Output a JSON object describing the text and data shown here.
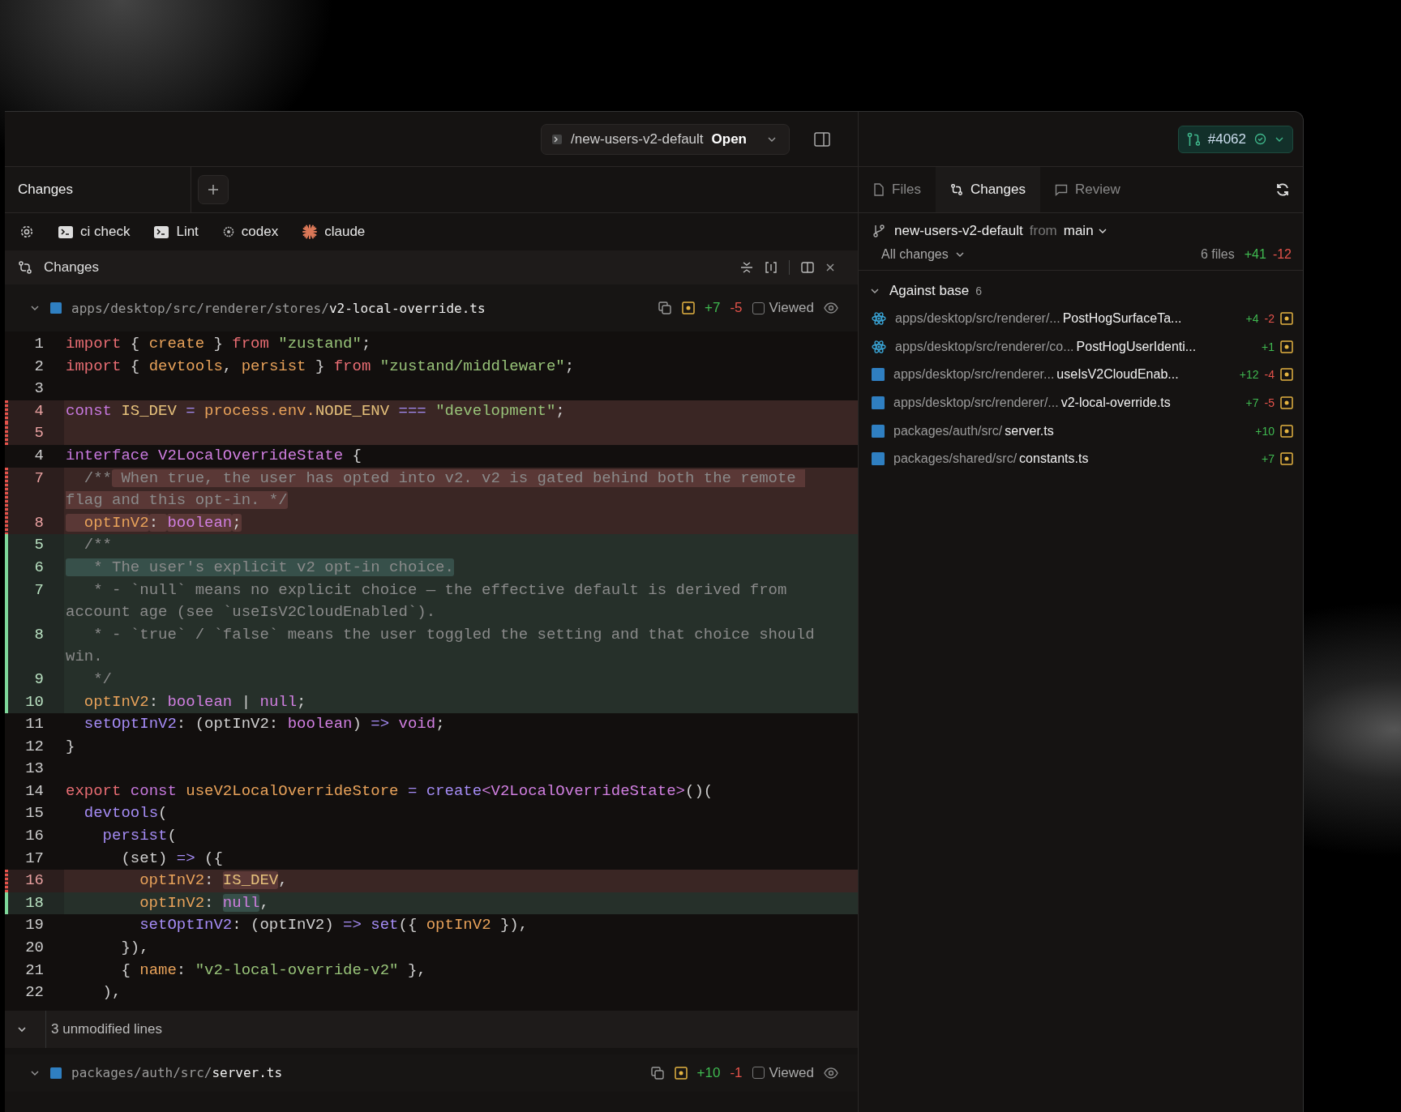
{
  "title_bar": {
    "branch_path": "/new-users-v2-default",
    "status": "Open",
    "pr_number": "#4062"
  },
  "left_tabs": [
    {
      "label": "Changes",
      "selected": true
    }
  ],
  "toolbar": [
    {
      "label": "ci check",
      "kind": "terminal"
    },
    {
      "label": "Lint",
      "kind": "terminal"
    },
    {
      "label": "codex",
      "kind": "codex"
    },
    {
      "label": "claude",
      "kind": "claude"
    }
  ],
  "changes_header": {
    "title": "Changes"
  },
  "files": [
    {
      "dir": "apps/desktop/src/renderer/stores/",
      "name": "v2-local-override.ts",
      "added": "+7",
      "removed": "-5",
      "viewed_label": "Viewed",
      "viewed": false,
      "collapsed_note": "3 unmodified lines",
      "lines": [
        {
          "n": "1",
          "kind": "context",
          "tokens": [
            {
              "t": "import",
              "kind": "kw",
              "hl": false
            },
            {
              "t": " { ",
              "kind": "p",
              "hl": false
            },
            {
              "t": "create",
              "kind": "id",
              "hl": false
            },
            {
              "t": " } ",
              "kind": "p",
              "hl": false
            },
            {
              "t": "from",
              "kind": "kw",
              "hl": false
            },
            {
              "t": " \"zustand\"",
              "kind": "str",
              "hl": false
            },
            {
              "t": ";",
              "kind": "p",
              "hl": false
            }
          ]
        },
        {
          "n": "2",
          "kind": "context",
          "tokens": [
            {
              "t": "import",
              "kind": "kw",
              "hl": false
            },
            {
              "t": " { ",
              "kind": "p",
              "hl": false
            },
            {
              "t": "devtools",
              "kind": "id",
              "hl": false
            },
            {
              "t": ", ",
              "kind": "p",
              "hl": false
            },
            {
              "t": "persist",
              "kind": "id",
              "hl": false
            },
            {
              "t": " } ",
              "kind": "p",
              "hl": false
            },
            {
              "t": "from",
              "kind": "kw",
              "hl": false
            },
            {
              "t": " \"zustand/middleware\"",
              "kind": "str",
              "hl": false
            },
            {
              "t": ";",
              "kind": "p",
              "hl": false
            }
          ]
        },
        {
          "n": "3",
          "kind": "context"
        },
        {
          "n": "4",
          "kind": "removed",
          "tokens": [
            {
              "t": "const",
              "kind": "st",
              "hl": false
            },
            {
              "t": " IS_DEV",
              "kind": "cn",
              "hl": false
            },
            {
              "t": " = ",
              "kind": "op",
              "hl": false
            },
            {
              "t": "process.env.",
              "kind": "id",
              "hl": false
            },
            {
              "t": "NODE_ENV",
              "kind": "cn",
              "hl": false
            },
            {
              "t": " === ",
              "kind": "op",
              "hl": false
            },
            {
              "t": "\"development\"",
              "kind": "str",
              "hl": false
            },
            {
              "t": ";",
              "kind": "p",
              "hl": false
            }
          ]
        },
        {
          "n": "5",
          "kind": "removed"
        },
        {
          "n": "4",
          "kind": "context",
          "tokens": [
            {
              "t": "interface",
              "kind": "st",
              "hl": false
            },
            {
              "t": " V2LocalOverrideState",
              "kind": "ty",
              "hl": false
            },
            {
              "t": " {",
              "kind": "p",
              "hl": false
            }
          ]
        },
        {
          "n": "7",
          "kind": "removed",
          "tokens": [
            {
              "t": "  /**",
              "kind": "cm",
              "hl": false
            },
            {
              "t": " When true, the user has opted into v2. v2 is gated behind both the remote flag and this opt-in. */",
              "kind": "cm",
              "hl": true
            }
          ]
        },
        {
          "n": "8",
          "kind": "removed",
          "tokens": [
            {
              "t": "  optInV2",
              "kind": "id",
              "hl": true
            },
            {
              "t": ": ",
              "kind": "p",
              "hl": true
            },
            {
              "t": "boolean",
              "kind": "ty",
              "hl": true
            },
            {
              "t": ";",
              "kind": "p",
              "hl": true
            }
          ]
        },
        {
          "n": "5",
          "kind": "added",
          "tokens": [
            {
              "t": "  /**",
              "kind": "cm",
              "hl": false
            }
          ]
        },
        {
          "n": "6",
          "kind": "added",
          "tokens": [
            {
              "t": "   * The user's explicit v2 opt-in choice.",
              "kind": "cm",
              "hl": true
            }
          ]
        },
        {
          "n": "7",
          "kind": "added",
          "tokens": [
            {
              "t": "   * - `null` means no explicit choice — the effective default is derived from account age (see `useIsV2CloudEnabled`).",
              "kind": "cm",
              "hl": false
            }
          ]
        },
        {
          "n": "8",
          "kind": "added",
          "tokens": [
            {
              "t": "   * - `true` / `false` means the user toggled the setting and that choice should win.",
              "kind": "cm",
              "hl": false
            }
          ]
        },
        {
          "n": "9",
          "kind": "added",
          "tokens": [
            {
              "t": "   */",
              "kind": "cm",
              "hl": false
            }
          ]
        },
        {
          "n": "10",
          "kind": "added",
          "tokens": [
            {
              "t": "  optInV2",
              "kind": "id",
              "hl": false
            },
            {
              "t": ": ",
              "kind": "p",
              "hl": false
            },
            {
              "t": "boolean",
              "kind": "ty",
              "hl": false
            },
            {
              "t": " | ",
              "kind": "p",
              "hl": false
            },
            {
              "t": "null",
              "kind": "ty",
              "hl": false
            },
            {
              "t": ";",
              "kind": "p",
              "hl": false
            }
          ]
        },
        {
          "n": "11",
          "kind": "context",
          "tokens": [
            {
              "t": "  setOptInV2",
              "kind": "fn",
              "hl": false
            },
            {
              "t": ": (optInV2: ",
              "kind": "p",
              "hl": false
            },
            {
              "t": "boolean",
              "kind": "ty",
              "hl": false
            },
            {
              "t": ")",
              "kind": "p",
              "hl": false
            },
            {
              "t": " => ",
              "kind": "op",
              "hl": false
            },
            {
              "t": "void",
              "kind": "ty",
              "hl": false
            },
            {
              "t": ";",
              "kind": "p",
              "hl": false
            }
          ]
        },
        {
          "n": "12",
          "kind": "context",
          "tokens": [
            {
              "t": "}",
              "kind": "p",
              "hl": false
            }
          ]
        },
        {
          "n": "13",
          "kind": "context"
        },
        {
          "n": "14",
          "kind": "context",
          "tokens": [
            {
              "t": "export",
              "kind": "kw",
              "hl": false
            },
            {
              "t": " const",
              "kind": "st",
              "hl": false
            },
            {
              "t": " useV2LocalOverrideStore",
              "kind": "id",
              "hl": false
            },
            {
              "t": " = ",
              "kind": "op",
              "hl": false
            },
            {
              "t": "create",
              "kind": "fn",
              "hl": false
            },
            {
              "t": "<V2LocalOverrideState>",
              "kind": "ty",
              "hl": false
            },
            {
              "t": "()(",
              "kind": "p",
              "hl": false
            }
          ]
        },
        {
          "n": "15",
          "kind": "context",
          "tokens": [
            {
              "t": "  devtools",
              "kind": "fn",
              "hl": false
            },
            {
              "t": "(",
              "kind": "p",
              "hl": false
            }
          ]
        },
        {
          "n": "16",
          "kind": "context",
          "tokens": [
            {
              "t": "    persist",
              "kind": "fn",
              "hl": false
            },
            {
              "t": "(",
              "kind": "p",
              "hl": false
            }
          ]
        },
        {
          "n": "17",
          "kind": "context",
          "tokens": [
            {
              "t": "      (set)",
              "kind": "p",
              "hl": false
            },
            {
              "t": " => ",
              "kind": "op",
              "hl": false
            },
            {
              "t": "({",
              "kind": "p",
              "hl": false
            }
          ]
        },
        {
          "n": "16",
          "kind": "removed",
          "tokens": [
            {
              "t": "        optInV2",
              "kind": "id",
              "hl": false
            },
            {
              "t": ": ",
              "kind": "p",
              "hl": false
            },
            {
              "t": "IS_DEV",
              "kind": "cn",
              "hl": true
            },
            {
              "t": ",",
              "kind": "p",
              "hl": false
            }
          ]
        },
        {
          "n": "18",
          "kind": "added",
          "tokens": [
            {
              "t": "        optInV2",
              "kind": "id",
              "hl": false
            },
            {
              "t": ": ",
              "kind": "p",
              "hl": false
            },
            {
              "t": "null",
              "kind": "ty",
              "hl": true
            },
            {
              "t": ",",
              "kind": "p",
              "hl": false
            }
          ]
        },
        {
          "n": "19",
          "kind": "context",
          "tokens": [
            {
              "t": "        setOptInV2",
              "kind": "fn",
              "hl": false
            },
            {
              "t": ": (optInV2)",
              "kind": "p",
              "hl": false
            },
            {
              "t": " => ",
              "kind": "op",
              "hl": false
            },
            {
              "t": "set",
              "kind": "fn",
              "hl": false
            },
            {
              "t": "({ ",
              "kind": "p",
              "hl": false
            },
            {
              "t": "optInV2",
              "kind": "id",
              "hl": false
            },
            {
              "t": " }),",
              "kind": "p",
              "hl": false
            }
          ]
        },
        {
          "n": "20",
          "kind": "context",
          "tokens": [
            {
              "t": "      }),",
              "kind": "p",
              "hl": false
            }
          ]
        },
        {
          "n": "21",
          "kind": "context",
          "tokens": [
            {
              "t": "      { ",
              "kind": "p",
              "hl": false
            },
            {
              "t": "name",
              "kind": "id",
              "hl": false
            },
            {
              "t": ": ",
              "kind": "p",
              "hl": false
            },
            {
              "t": "\"v2-local-override-v2\"",
              "kind": "str",
              "hl": false
            },
            {
              "t": " },",
              "kind": "p",
              "hl": false
            }
          ]
        },
        {
          "n": "22",
          "kind": "context",
          "tokens": [
            {
              "t": "    ),",
              "kind": "p",
              "hl": false
            }
          ]
        }
      ]
    },
    {
      "dir": "packages/auth/src/",
      "name": "server.ts",
      "added": "+10",
      "removed": "-1",
      "viewed_label": "Viewed",
      "viewed": false
    }
  ],
  "right_panel": {
    "tabs": [
      {
        "label": "Files",
        "kind": "file",
        "selected": false
      },
      {
        "label": "Changes",
        "kind": "diff",
        "selected": true
      },
      {
        "label": "Review",
        "kind": "comment",
        "selected": false
      }
    ],
    "branch": "new-users-v2-default",
    "from": "from",
    "base": "main",
    "filter": "All changes",
    "summary": {
      "files": "6 files",
      "added": "+41",
      "removed": "-12"
    },
    "group": {
      "title": "Against base",
      "count": "6"
    },
    "items": [
      {
        "dir": "apps/desktop/src/renderer/...",
        "name": "PostHogSurfaceTa...",
        "kind": "react",
        "added": "+4",
        "removed": "-2"
      },
      {
        "dir": "apps/desktop/src/renderer/co...",
        "name": "PostHogUserIdenti...",
        "kind": "react",
        "added": "+1"
      },
      {
        "dir": "apps/desktop/src/renderer...",
        "name": "useIsV2CloudEnab...",
        "kind": "ts",
        "added": "+12",
        "removed": "-4"
      },
      {
        "dir": "apps/desktop/src/renderer/...",
        "name": "v2-local-override.ts",
        "kind": "ts",
        "added": "+7",
        "removed": "-5"
      },
      {
        "dir": "packages/auth/src/",
        "name": "server.ts",
        "kind": "ts",
        "added": "+10"
      },
      {
        "dir": "packages/shared/src/",
        "name": "constants.ts",
        "kind": "ts",
        "added": "+7"
      }
    ]
  }
}
